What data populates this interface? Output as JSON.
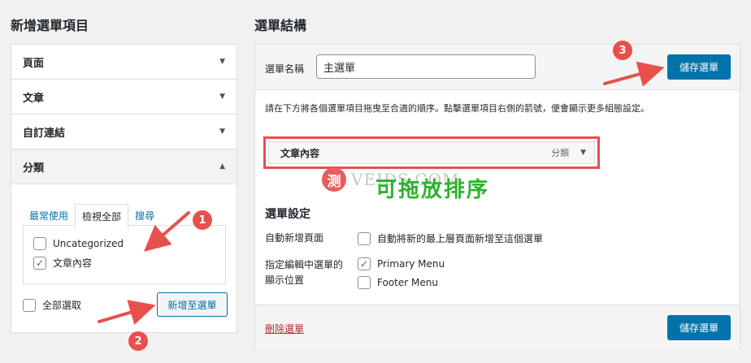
{
  "left": {
    "heading": "新增選單項目",
    "sections": [
      "頁面",
      "文章",
      "自訂連結",
      "分類"
    ],
    "tabs": [
      "最常使用",
      "檢視全部",
      "搜尋"
    ],
    "categories": [
      "Uncategorized",
      "文章內容"
    ],
    "select_all": "全部選取",
    "add_button": "新增至選單"
  },
  "right": {
    "heading": "選單結構",
    "name_label": "選單名稱",
    "name_value": "主選單",
    "save_button": "儲存選單",
    "instructions": "請在下方將各個選單項目拖曳至合適的順序。點擊選單項目右側的箭號，便會顯示更多組態設定。",
    "menu_item": {
      "title": "文章內容",
      "type": "分類"
    },
    "settings": {
      "title": "選單設定",
      "auto_add_label": "自動新增頁面",
      "auto_add_option": "自動將新的最上層頁面新增至這個選單",
      "location_label_1": "指定編輯中選單的",
      "location_label_2": "顯示位置",
      "locations": [
        "Primary Menu",
        "Footer Menu"
      ]
    },
    "delete_link": "刪除選單"
  },
  "annotations": {
    "badges": [
      "1",
      "2",
      "3"
    ],
    "drag_label": "可拖放排序",
    "watermark_seal": "测",
    "watermark_text": "VEIDS.COM",
    "color": "#e8504d"
  }
}
